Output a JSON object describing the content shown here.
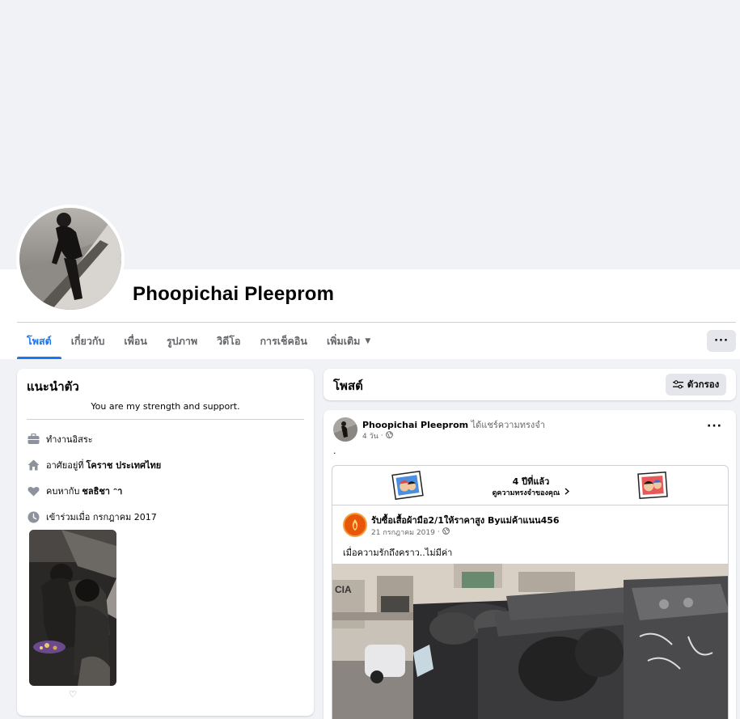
{
  "profile": {
    "name": "Phoopichai Pleeprom"
  },
  "tabs": [
    {
      "label": "โพสต์",
      "active": true
    },
    {
      "label": "เกี่ยวกับ"
    },
    {
      "label": "เพื่อน"
    },
    {
      "label": "รูปภาพ"
    },
    {
      "label": "วิดีโอ"
    },
    {
      "label": "การเช็คอิน"
    },
    {
      "label": "เพิ่มเติม",
      "has_caret": true
    }
  ],
  "more_button": {
    "label": "···"
  },
  "intro": {
    "title": "แนะนำตัว",
    "bio": "You are my strength and support.",
    "items": [
      {
        "icon": "briefcase-icon",
        "text": "ทำงานอิสระ",
        "bold": ""
      },
      {
        "icon": "home-icon",
        "text": "อาศัยอยู่ที่",
        "bold": "โคราช ประเทศไทย"
      },
      {
        "icon": "heart-icon",
        "text": "คบหากับ",
        "bold": "ชลธิชา ᵔา"
      },
      {
        "icon": "clock-icon",
        "text": "เข้าร่วมเมื่อ กรกฎาคม 2017",
        "bold": ""
      }
    ],
    "photo_like": "♡"
  },
  "posts_header": {
    "title": "โพสต์",
    "filter_label": "ตัวกรอง"
  },
  "post": {
    "author": "Phoopichai Pleeprom",
    "action": "ได้แชร์ความทรงจำ",
    "time": "4 วัน",
    "text": ".",
    "menu": "···",
    "memory": {
      "title": "4 ปีที่แล้ว",
      "subtitle": "ดูความทรงจำของคุณ",
      "shared": {
        "page_name": "รับซื้อเสื้อผ้ามือ2/1ให้ราคาสูง Byแม่ค้าแนน456",
        "date": "21 กรกฎาคม 2019",
        "text": "เมื่อความรักถึงคราว..ไม่มีค่า"
      }
    }
  },
  "colors": {
    "accent": "#1877f2",
    "secondary_text": "#65676b",
    "button_bg": "#e4e6eb"
  }
}
